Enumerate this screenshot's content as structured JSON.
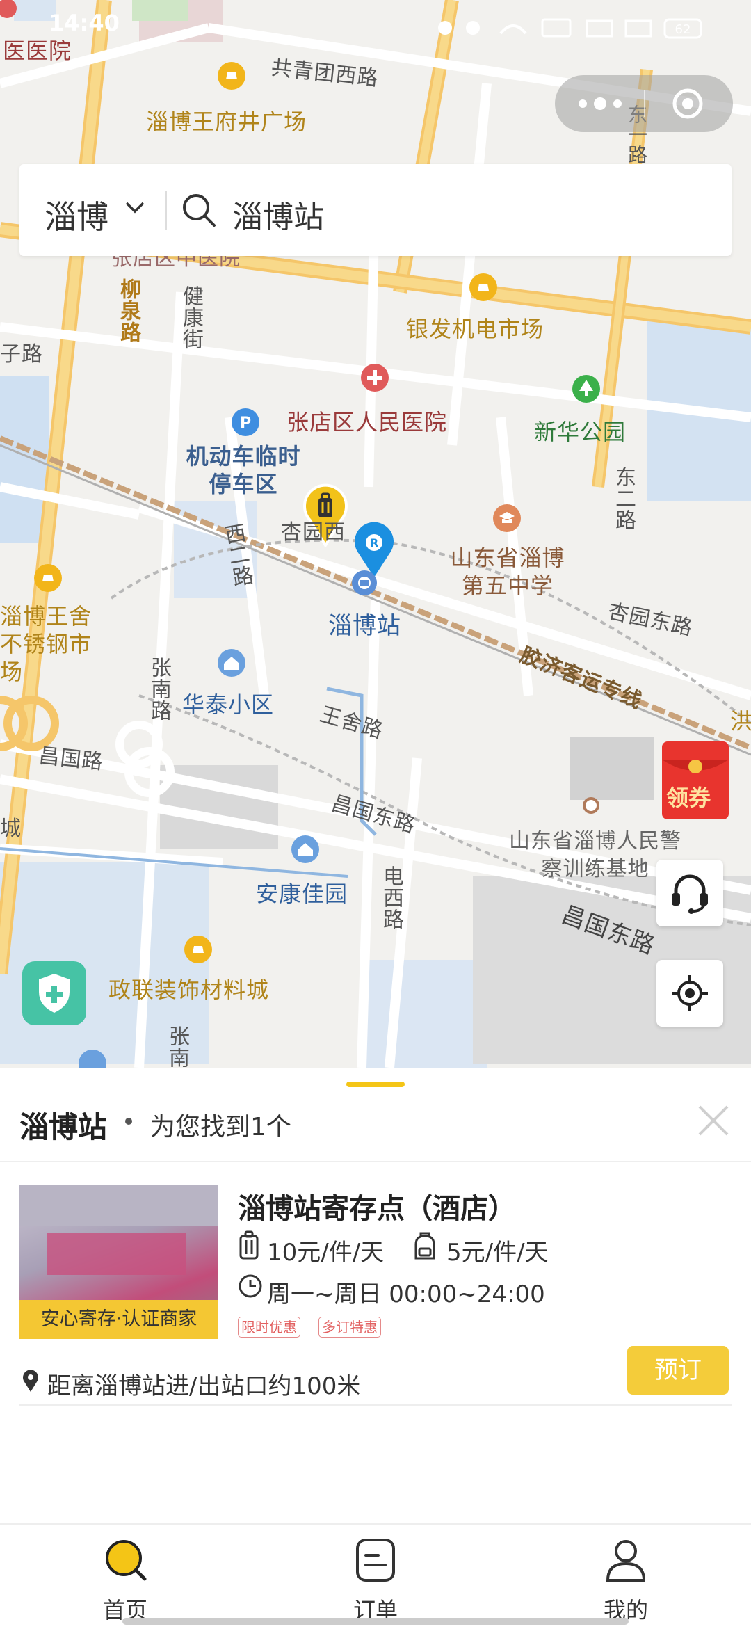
{
  "status_bar": {
    "time": "14:40",
    "battery": "62"
  },
  "search": {
    "city": "淄博",
    "query": "淄博站"
  },
  "map": {
    "labels": {
      "hospital_top": "医医院",
      "gongqingtuan_road": "共青团西路",
      "wangfujing": "淄博王府井广场",
      "dong_road_top": "东一路",
      "zhangdian_clipped": "张店区中医院",
      "liuquan_road": "柳泉路",
      "jiankang_street": "健康街",
      "yinfa": "银发机电市场",
      "road_left": "子路",
      "zhangdian_hospital": "张店区人民医院",
      "xinhua_park": "新华公园",
      "parking": "机动车临时停车区",
      "dong_er_road": "东二路",
      "xingyuan_west": "杏园西",
      "school": "山东省淄博第五中学",
      "xi_er_road": "西二路",
      "station": "淄博站",
      "steel_market": "淄博王舍不锈钢市场",
      "xingyuan_east": "杏园东路",
      "railway": "胶济客运专线",
      "zhangnan_road": "张南路",
      "huatai": "华泰小区",
      "wangshe_road": "王舍路",
      "changguo_road": "昌国路",
      "changguo_east_1": "昌国东路",
      "police_school": "山东省淄博人民警察训练基地",
      "ankang": "安康佳园",
      "dianxi_road": "电西路",
      "changguo_east_2": "昌国东路",
      "zhenglian": "政联装饰材料城",
      "zhangnan_bottom": "张南",
      "hong_right": "洪",
      "cheng_left": "城"
    },
    "coupon_label": "领券"
  },
  "sheet": {
    "title": "淄博站",
    "count_text": "为您找到1个"
  },
  "store": {
    "badge": "安心寄存·认证商家",
    "name": "淄博站寄存点（酒店）",
    "price_large": "10元/件/天",
    "price_small": "5元/件/天",
    "hours": "周一~周日 00:00~24:00",
    "tags": [
      "限时优惠",
      "多订特惠"
    ],
    "distance": "距离淄博站进/出站口约100米",
    "book_label": "预订"
  },
  "tabs": [
    {
      "label": "首页",
      "icon": "search-icon"
    },
    {
      "label": "订单",
      "icon": "order-icon"
    },
    {
      "label": "我的",
      "icon": "user-icon"
    }
  ],
  "colors": {
    "accent": "#f4c516",
    "book_button": "#f4cc3a",
    "pin_blue": "#1b8fe0",
    "shield": "#46c3a5",
    "coupon_red": "#e8342e"
  }
}
